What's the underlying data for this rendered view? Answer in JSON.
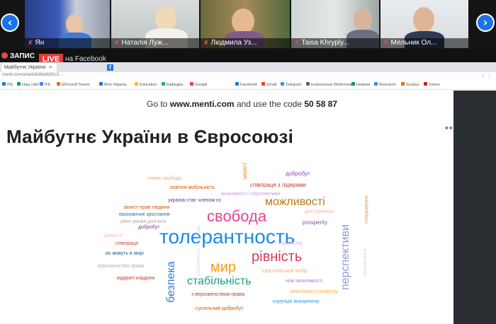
{
  "video": {
    "participants": [
      {
        "name": "Ян",
        "muted": true
      },
      {
        "name": "Наталія Луж...",
        "muted": true
      },
      {
        "name": "Людмила Уз...",
        "muted": true
      },
      {
        "name": "Taisa Khryply...",
        "muted": true
      },
      {
        "name": "Мельник Ол...",
        "muted": true
      }
    ],
    "nav": {
      "prev": "‹",
      "next": "›"
    }
  },
  "recording": {
    "label": "ЗАПИС",
    "live_badge": "LIVE",
    "live_text": "на Facebook"
  },
  "browser": {
    "tab_title": "Майбутнє України",
    "address": "menti.com/al/ai4a5d8a6b30c3...",
    "bookmarks": [
      "IFE",
      "Наш сайт",
      "IFE",
      "Microsoft Teams",
      "Моя Україна",
      "Education",
      "Кафедра",
      "Google",
      "Facebook",
      "Gmail",
      "Telegram",
      "Електронна бібліотека",
      "Новини",
      "Research",
      "Scopus",
      "Zotero"
    ]
  },
  "slide": {
    "join_prefix": "Go to",
    "join_site": "www.menti.com",
    "join_middle": "and use the code",
    "join_code": "50 58 87",
    "title": "Майбутнє України в Євросоюзі",
    "words": [
      "толерантность",
      "свобода",
      "рівність",
      "можливості",
      "мир",
      "стабільність",
      "безпека",
      "перспективи",
      "співпраця з лідерами",
      "добробут",
      "захист",
      "повна свобода",
      "освітня мобільність",
      "можливості і перспективи",
      "україна стає членом єс",
      "захист прав людини",
      "економічне зростання",
      "рівні умови для всіх",
      "добробут",
      "prosperity",
      "цінності",
      "співпраця",
      "во живуть в мирі",
      "верховенство права",
      "відкриті кордони",
      "європейський вибір",
      "нові можливості",
      "стабільність і свобода",
      "з верховенством права",
      "корупція викорінена",
      "можливості розвитку",
      "суспільний добробут",
      "покращення",
      "процвітання",
      "дослідження",
      "уряд",
      "розвиток"
    ]
  },
  "colors": {
    "accent_blue": "#1a73e8",
    "live_red": "#e53935",
    "word_blue": "#1e88e5",
    "word_pink": "#e84393",
    "word_red": "#d63b5a",
    "word_orange": "#f39c12",
    "word_teal": "#16a085"
  }
}
